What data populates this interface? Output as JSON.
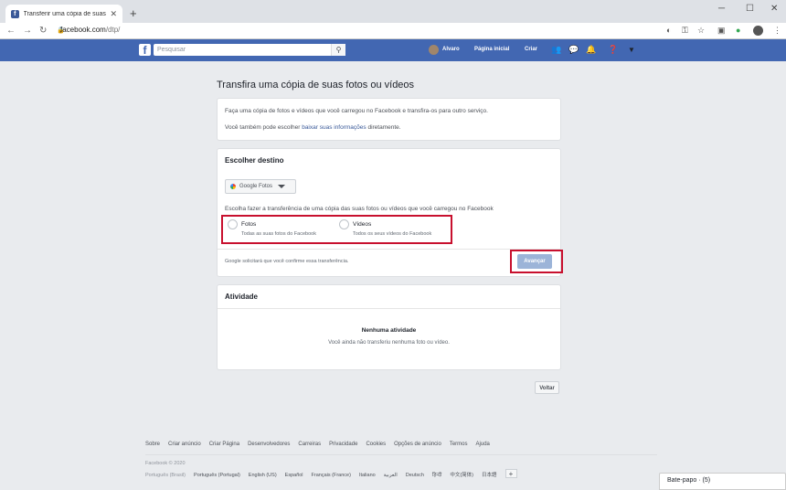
{
  "browser": {
    "tab_title": "Transferir uma cópia de suas fotos",
    "url_host": "facebook.com",
    "url_path": "/dtp/"
  },
  "fb_header": {
    "search_placeholder": "Pesquisar",
    "user_name": "Alvaro",
    "home_label": "Página inicial",
    "create_label": "Criar"
  },
  "page": {
    "heading": "Transfira uma cópia de suas fotos ou vídeos",
    "intro": "Faça uma cópia de fotos e vídeos que você carregou no Facebook e transfira-os para outro serviço.",
    "download_prefix": "Você também pode escolher ",
    "download_link": "baixar suas informações",
    "download_suffix": " diretamente."
  },
  "destination": {
    "title": "Escolher destino",
    "selected": "Google Fotos",
    "choose_text": "Escolha fazer a transferência de uma cópia das suas fotos ou vídeos que você carregou no Facebook",
    "options": [
      {
        "label": "Fotos",
        "sub": "Todas as suas fotos do Facebook"
      },
      {
        "label": "Vídeos",
        "sub": "Todos os seus vídeos do Facebook"
      }
    ],
    "confirm_note": "Google solicitará que você confirme essa transferência.",
    "next_label": "Avançar"
  },
  "activity": {
    "title": "Atividade",
    "empty_title": "Nenhuma atividade",
    "empty_text": "Você ainda não transferiu nenhuma foto ou vídeo."
  },
  "back_label": "Voltar",
  "footer": {
    "links": [
      "Sobre",
      "Criar anúncio",
      "Criar Página",
      "Desenvolvedores",
      "Carreiras",
      "Privacidade",
      "Cookies",
      "Opções de anúncio",
      "Termos",
      "Ajuda"
    ],
    "copyright": "Facebook © 2020",
    "languages": [
      "Português (Brasil)",
      "Português (Portugal)",
      "English (US)",
      "Español",
      "Français (France)",
      "Italiano",
      "العربية",
      "Deutsch",
      "हिन्दी",
      "中文(简体)",
      "日本語"
    ]
  },
  "chat": {
    "label": "Bate-papo · (5)"
  },
  "colors": {
    "brand": "#4267b2",
    "highlight": "#c8102e",
    "button_disabled": "#9cb4d8"
  }
}
